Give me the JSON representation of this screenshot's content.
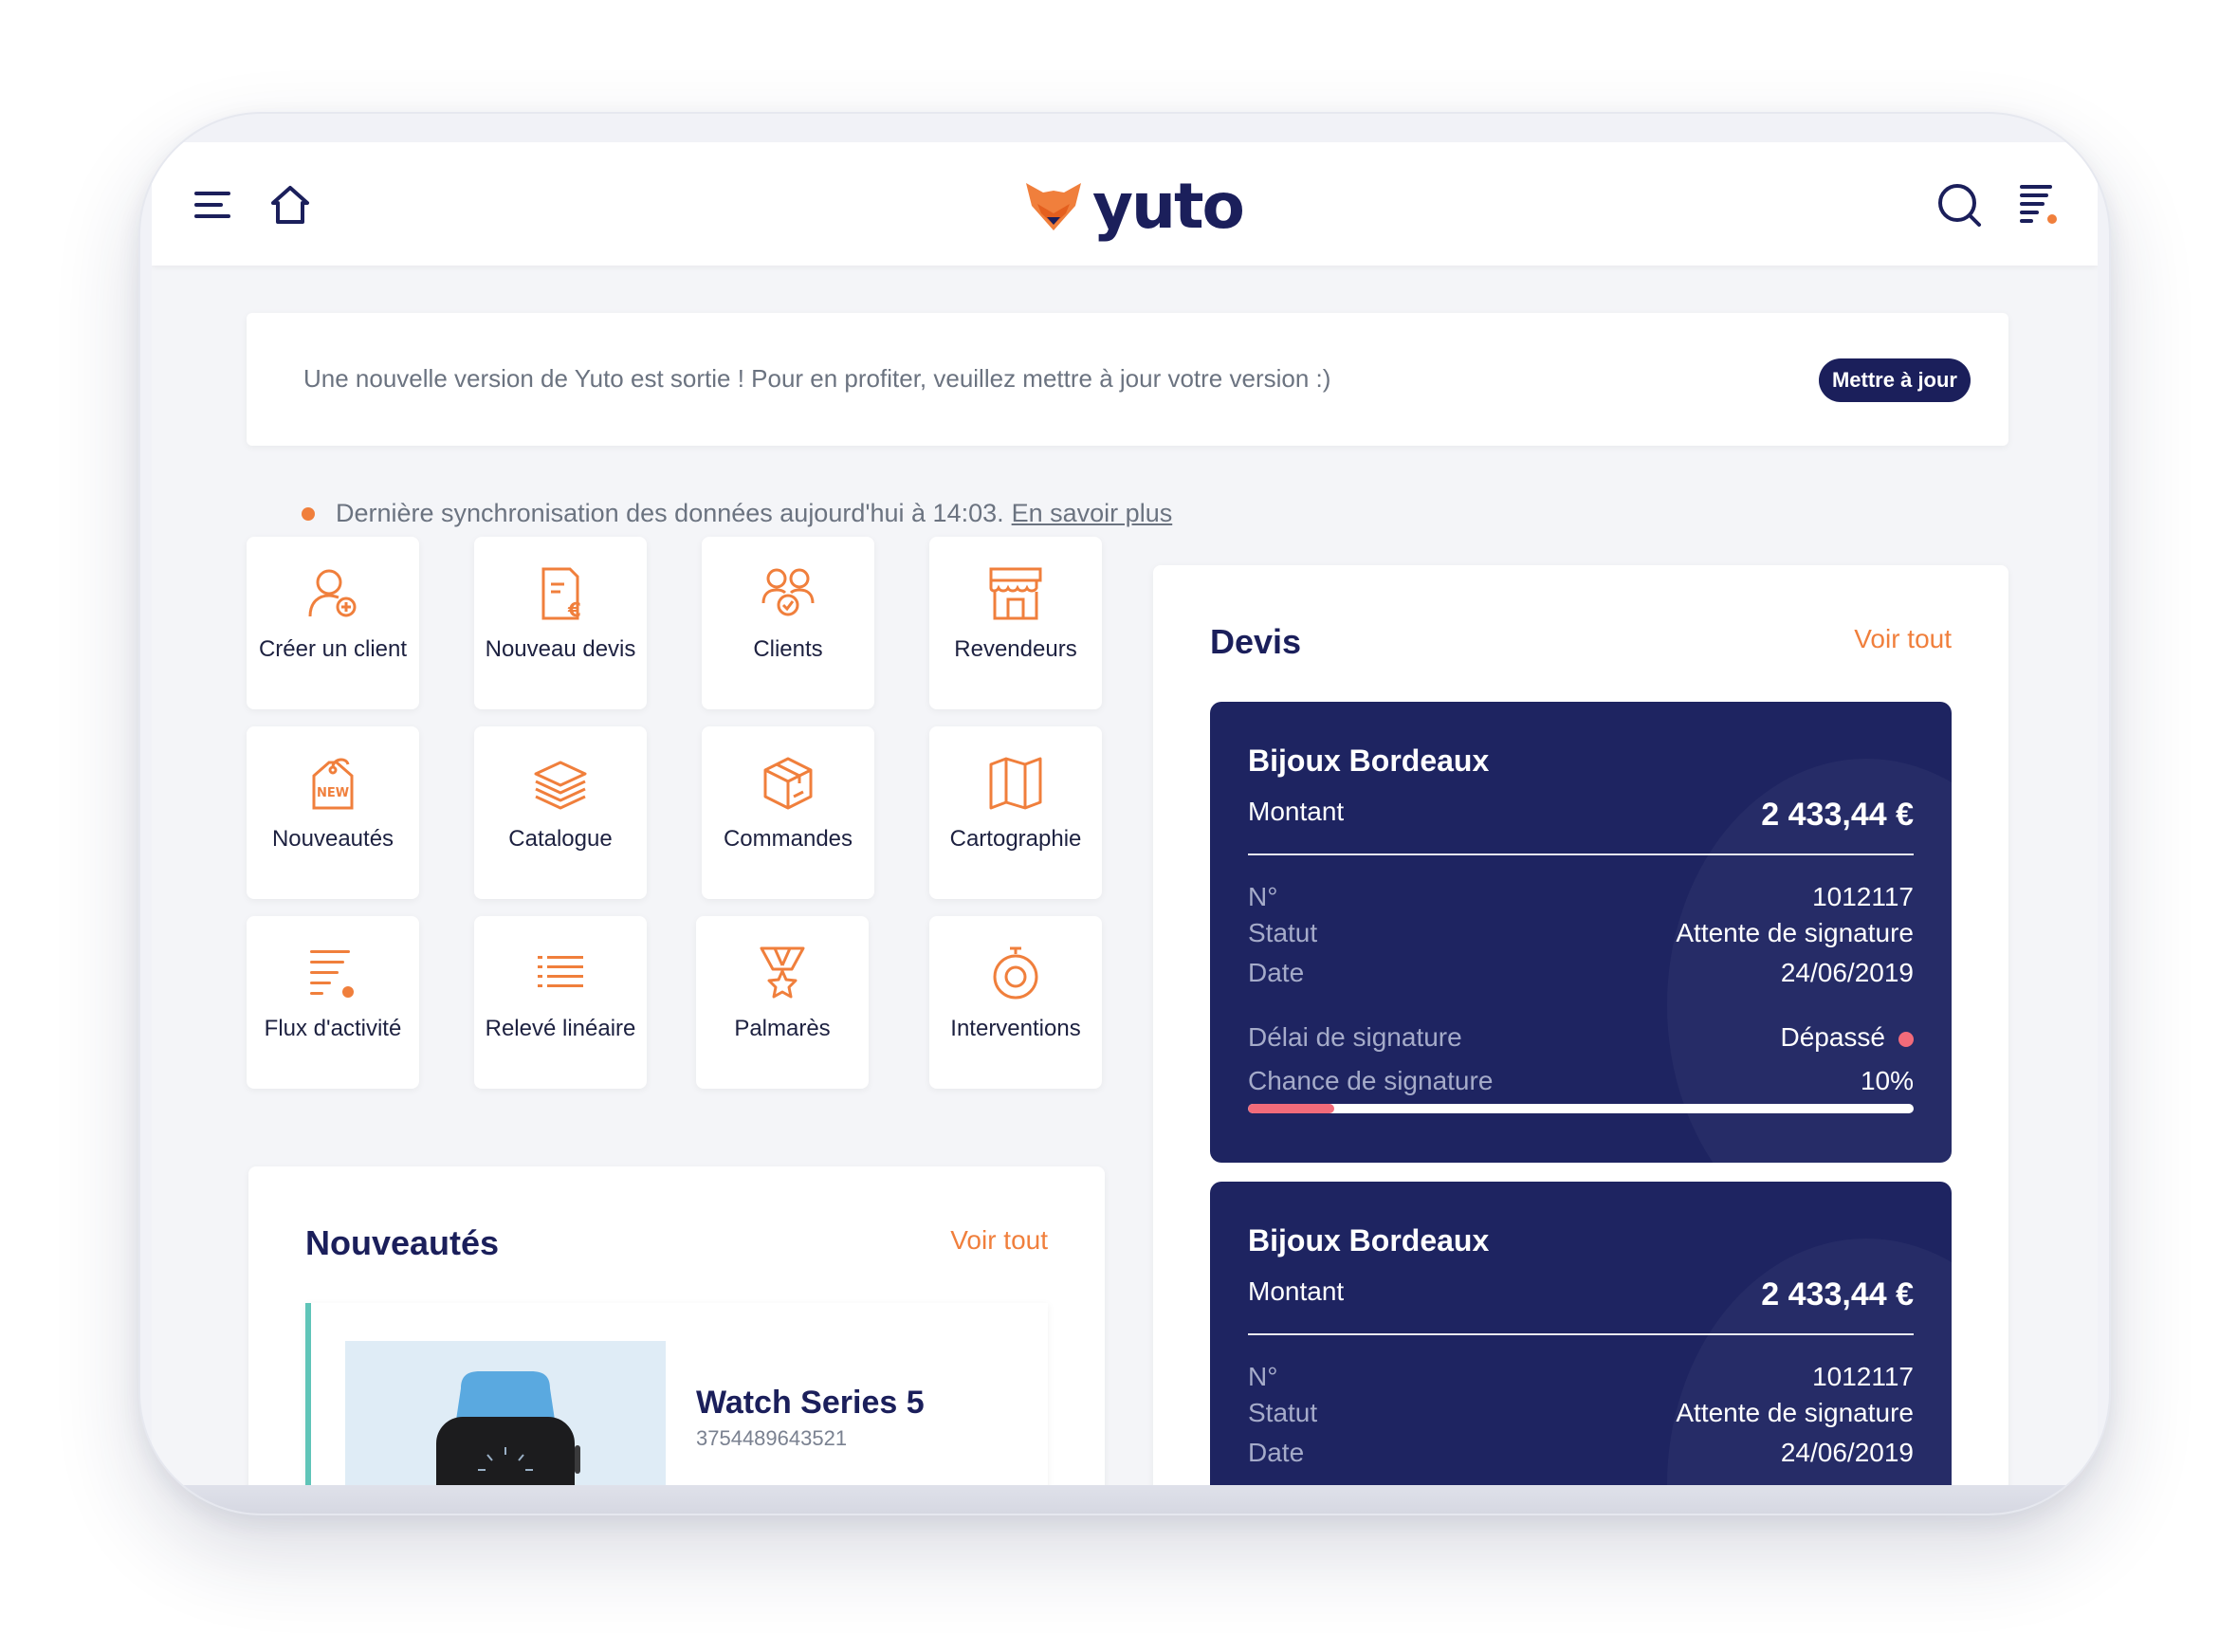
{
  "app": {
    "logo_text": "yuto",
    "brand_color": "#1b1f5b",
    "accent_color": "#f07f3c",
    "icons": {
      "menu": "menu-icon",
      "home": "home-icon",
      "search": "search-icon",
      "filter": "activity-feed-icon"
    }
  },
  "banner": {
    "message": "Une nouvelle version de Yuto est sortie ! Pour en profiter, veuillez mettre à jour votre version :)",
    "button_label": "Mettre à jour"
  },
  "sync": {
    "text": "Dernière synchronisation des données aujourd'hui à 14:03.",
    "link_label": "En savoir plus"
  },
  "tiles": [
    {
      "label": "Créer un client",
      "icon": "add-user-icon"
    },
    {
      "label": "Nouveau devis",
      "icon": "quote-document-icon"
    },
    {
      "label": "Clients",
      "icon": "clients-icon"
    },
    {
      "label": "Revendeurs",
      "icon": "store-icon"
    },
    {
      "label": "Nouveautés",
      "icon": "new-tag-icon"
    },
    {
      "label": "Catalogue",
      "icon": "layers-icon"
    },
    {
      "label": "Commandes",
      "icon": "package-icon"
    },
    {
      "label": "Cartographie",
      "icon": "map-icon"
    },
    {
      "label": "Flux d'activité",
      "icon": "activity-feed-icon"
    },
    {
      "label": "Relevé linéaire",
      "icon": "list-icon"
    },
    {
      "label": "Palmarès",
      "icon": "medal-icon"
    },
    {
      "label": "Interventions",
      "icon": "stopwatch-icon"
    }
  ],
  "nouveautes": {
    "title": "Nouveautés",
    "see_all": "Voir tout",
    "product": {
      "name": "Watch Series 5",
      "reference": "3754489643521"
    }
  },
  "devis": {
    "title": "Devis",
    "see_all": "Voir tout",
    "quotes": [
      {
        "client": "Bijoux Bordeaux",
        "amount_label": "Montant",
        "amount": "2 433,44 €",
        "number_label": "N°",
        "number": "1012117",
        "status_label": "Statut",
        "status": "Attente de signature",
        "date_label": "Date",
        "date": "24/06/2019",
        "delay_label": "Délai de signature",
        "delay_value": "Dépassé",
        "chance_label": "Chance de signature",
        "chance_value": "10%",
        "chance_fraction": 0.13
      },
      {
        "client": "Bijoux Bordeaux",
        "amount_label": "Montant",
        "amount": "2 433,44 €",
        "number_label": "N°",
        "number": "1012117",
        "status_label": "Statut",
        "status": "Attente de signature",
        "date_label": "Date",
        "date": "24/06/2019"
      }
    ]
  }
}
